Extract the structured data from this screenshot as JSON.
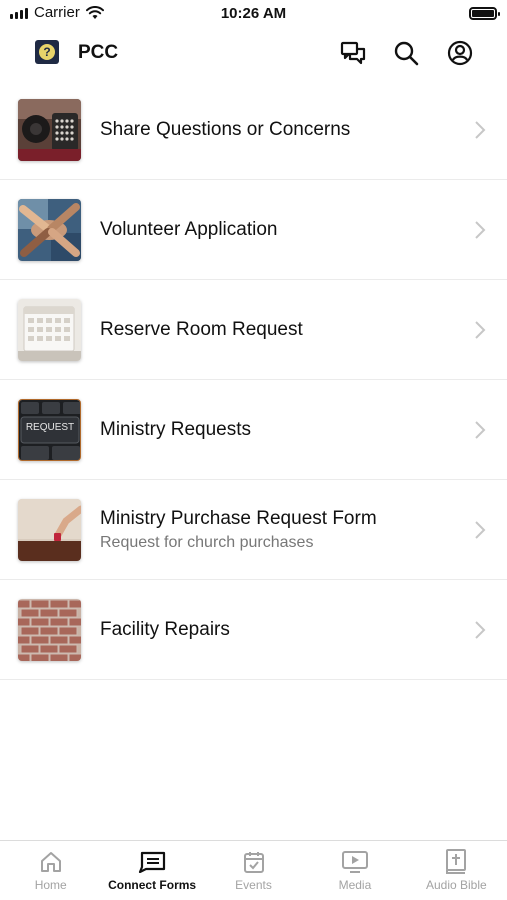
{
  "status_bar": {
    "carrier": "Carrier",
    "time": "10:26 AM"
  },
  "header": {
    "title": "PCC",
    "logo_glyph": "?",
    "icons": [
      "messages-icon",
      "search-icon",
      "account-icon"
    ]
  },
  "forms": [
    {
      "title": "Share Questions or Concerns",
      "subtitle": ""
    },
    {
      "title": "Volunteer Application",
      "subtitle": ""
    },
    {
      "title": "Reserve Room Request",
      "subtitle": ""
    },
    {
      "title": "Ministry Requests",
      "subtitle": "",
      "thumb_text": "REQUEST"
    },
    {
      "title": "Ministry Purchase Request Form",
      "subtitle": "Request for church purchases"
    },
    {
      "title": "Facility Repairs",
      "subtitle": ""
    }
  ],
  "tabbar": {
    "tabs": [
      {
        "label": "Home",
        "icon": "home-icon",
        "active": false
      },
      {
        "label": "Connect Forms",
        "icon": "forms-icon",
        "active": true
      },
      {
        "label": "Events",
        "icon": "calendar-icon",
        "active": false
      },
      {
        "label": "Media",
        "icon": "media-icon",
        "active": false
      },
      {
        "label": "Audio Bible",
        "icon": "bible-icon",
        "active": false
      }
    ]
  },
  "colors": {
    "text": "#111111",
    "subtitle": "#777777",
    "tab_inactive": "#a3a3a3",
    "divider": "#ebebeb"
  }
}
